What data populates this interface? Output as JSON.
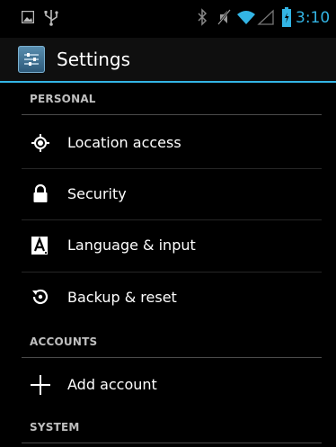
{
  "status_bar": {
    "time": "3:10",
    "icons": [
      "picture-icon",
      "usb-icon",
      "bluetooth-icon",
      "mute-icon",
      "wifi-icon",
      "signal-icon",
      "battery-icon"
    ],
    "accent": "#33b5e5"
  },
  "action_bar": {
    "title": "Settings",
    "icon": "settings-app-icon"
  },
  "sections": {
    "personal": {
      "header": "PERSONAL",
      "items": [
        {
          "label": "Location access",
          "icon": "location-icon"
        },
        {
          "label": "Security",
          "icon": "lock-icon"
        },
        {
          "label": "Language & input",
          "icon": "keyboard-a-icon"
        },
        {
          "label": "Backup & reset",
          "icon": "backup-icon"
        }
      ]
    },
    "accounts": {
      "header": "ACCOUNTS",
      "items": [
        {
          "label": "Add account",
          "icon": "plus-icon"
        }
      ]
    },
    "system": {
      "header": "SYSTEM"
    }
  },
  "colors": {
    "background": "#000000",
    "accent": "#33b5e5",
    "header_text": "#bfbfbf"
  }
}
